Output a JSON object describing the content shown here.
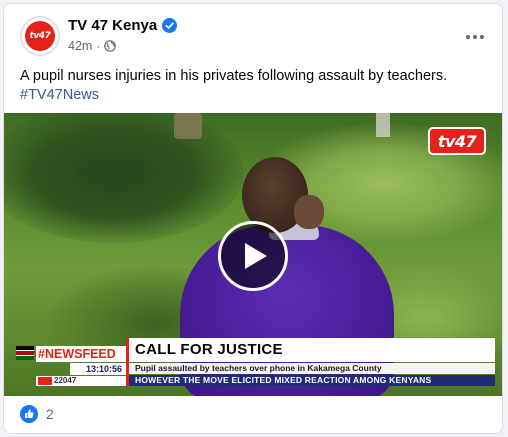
{
  "post": {
    "page_name": "TV 47 Kenya",
    "avatar_text": "tv47",
    "time": "42m",
    "separator": "·",
    "text": "A pupil nurses injuries in his privates following assault by teachers.",
    "hashtag": "#TV47News",
    "reaction_count": "2"
  },
  "video": {
    "channel_logo": "tv47",
    "newsfeed_label": "#NEWSFEED",
    "clock": "13:10:56",
    "ticker_number": "22047",
    "headline": "CALL FOR JUSTICE",
    "subheadline": "Pupil assaulted by teachers over phone in Kakamega County",
    "ticker": "HOWEVER THE MOVE ELICITED MIXED REACTION AMONG KENYANS"
  },
  "icons": {
    "verified": "verified-badge-icon",
    "audience": "globe-icon",
    "more": "more-options-icon",
    "play": "play-icon",
    "like": "like-icon"
  },
  "colors": {
    "brand_red": "#e2231a",
    "verified_blue": "#1877f2",
    "hashtag_blue": "#385898",
    "ticker_navy": "#1f2a78"
  }
}
